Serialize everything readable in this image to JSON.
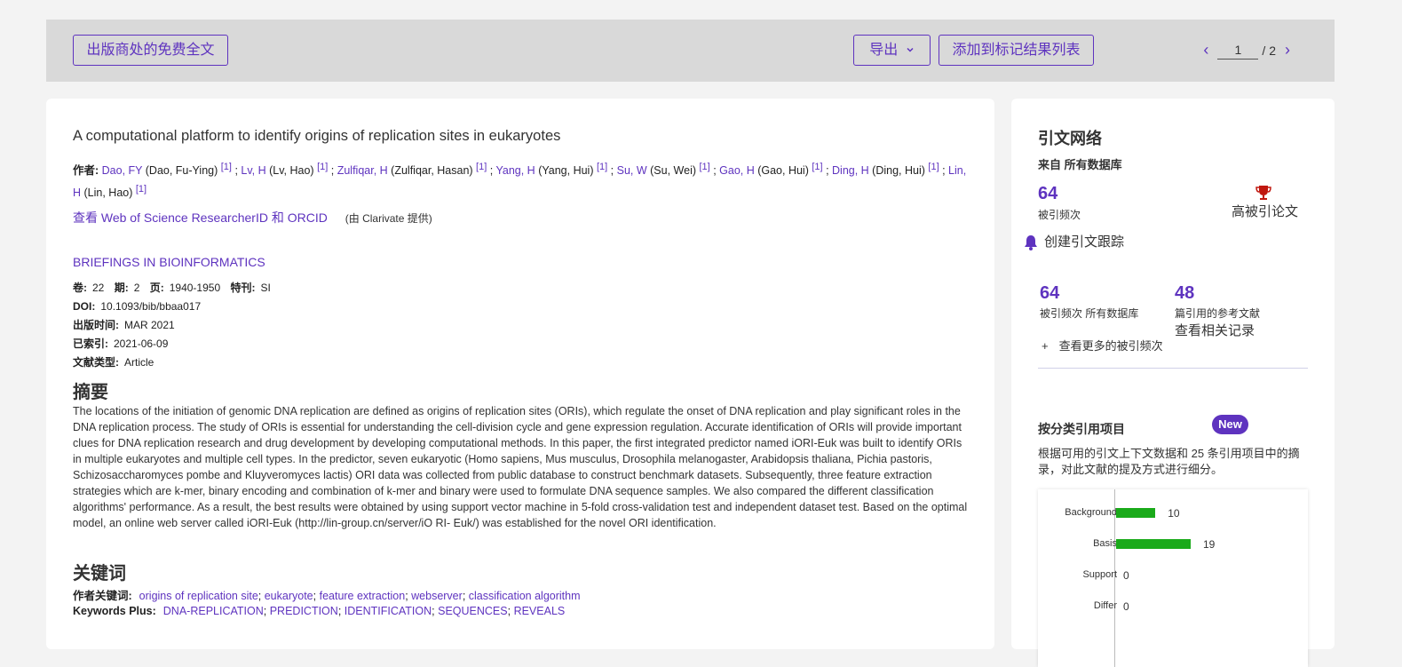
{
  "toolbar": {
    "free_fulltext": "出版商处的免费全文",
    "export": "导出",
    "add_marked": "添加到标记结果列表",
    "page_current": "1",
    "page_total": "/ 2",
    "prev_icon": "chevron-left-icon",
    "next_icon": "chevron-right-icon"
  },
  "record": {
    "title": "A computational platform to identify origins of replication sites in eukaryotes",
    "authors_label": "作者:",
    "authors": [
      {
        "short": "Dao, FY",
        "full": "(Dao, Fu-Ying)",
        "aff": "[1]"
      },
      {
        "short": "Lv, H",
        "full": "(Lv, Hao)",
        "aff": "[1]"
      },
      {
        "short": "Zulfiqar, H",
        "full": "(Zulfiqar, Hasan)",
        "aff": "[1]"
      },
      {
        "short": "Yang, H",
        "full": "(Yang, Hui)",
        "aff": "[1]"
      },
      {
        "short": "Su, W",
        "full": "(Su, Wei)",
        "aff": "[1]"
      },
      {
        "short": "Gao, H",
        "full": "(Gao, Hui)",
        "aff": "[1]"
      },
      {
        "short": "Ding, H",
        "full": "(Ding, Hui)",
        "aff": "[1]"
      },
      {
        "short": "Lin, H",
        "full": "(Lin, Hao)",
        "aff": "[1]"
      }
    ],
    "researcher_link": "查看 Web of Science ResearcherID 和 ORCID",
    "researcher_note": "(由 Clarivate 提供)",
    "journal": "BRIEFINGS IN BIOINFORMATICS",
    "volume_label": "卷:",
    "volume": "22",
    "issue_label": "期:",
    "issue": "2",
    "pages_label": "页:",
    "pages": "1940-1950",
    "special_label": "特刊:",
    "special": "SI",
    "doi_label": "DOI:",
    "doi": "10.1093/bib/bbaa017",
    "pubdate_label": "出版时间:",
    "pubdate": "MAR 2021",
    "indexed_label": "已索引:",
    "indexed": "2021-06-09",
    "doctype_label": "文献类型:",
    "doctype": "Article",
    "abstract_heading": "摘要",
    "abstract": "The locations of the initiation of genomic DNA replication are defined as origins of replication sites (ORIs), which regulate the onset of DNA replication and play significant roles in the DNA replication process. The study of ORIs is essential for understanding the cell-division cycle and gene expression regulation. Accurate identification of ORIs will provide important clues for DNA replication research and drug development by developing computational methods. In this paper, the first integrated predictor named iORI-Euk was built to identify ORIs in multiple eukaryotes and multiple cell types. In the predictor, seven eukaryotic (Homo sapiens, Mus musculus, Drosophila melanogaster, Arabidopsis thaliana, Pichia pastoris, Schizosaccharomyces pombe and Kluyveromyces lactis) ORI data was collected from public database to construct benchmark datasets. Subsequently, three feature extraction strategies which are k-mer, binary encoding and combination of k-mer and binary were used to formulate DNA sequence samples. We also compared the different classification algorithms' performance. As a result, the best results were obtained by using support vector machine in 5-fold cross-validation test and independent dataset test. Based on the optimal model, an online web server called iORI-Euk (http://lin-group.cn/server/iO RI- Euk/) was established for the novel ORI identification.",
    "keywords_heading": "关键词",
    "author_kw_label": "作者关键词:",
    "author_keywords": [
      "origins of replication site",
      "eukaryote",
      "feature extraction",
      "webserver",
      "classification algorithm"
    ],
    "kwplus_label": "Keywords Plus:",
    "keywords_plus": [
      "DNA-REPLICATION",
      "PREDICTION",
      "IDENTIFICATION",
      "SEQUENCES",
      "REVEALS"
    ]
  },
  "sidebar": {
    "title": "引文网络",
    "source": "来自 所有数据库",
    "times_cited": "64",
    "times_cited_label": "被引频次",
    "highly_cited_label": "高被引论文",
    "trophy_icon": "trophy-icon",
    "create_alert": "创建引文跟踪",
    "bell_icon": "bell-icon",
    "all_db_count": "64",
    "all_db_label": "被引频次 所有数据库",
    "refs_count": "48",
    "refs_label": "篇引用的参考文献",
    "related_link": "查看相关记录",
    "more_cited": "查看更多的被引频次",
    "plus_icon": "plus-icon",
    "classified_title": "按分类引用项目",
    "new_badge": "New",
    "classified_desc": "根据可用的引文上下文数据和 25 条引用项目中的摘录，对此文献的提及方式进行细分。",
    "accent_color": "#5e33bf",
    "bar_color": "#1aaa1a"
  },
  "chart_data": {
    "type": "bar",
    "orientation": "horizontal",
    "categories": [
      "Background",
      "Basis",
      "Support",
      "Differ"
    ],
    "values": [
      10,
      19,
      0,
      0
    ]
  }
}
